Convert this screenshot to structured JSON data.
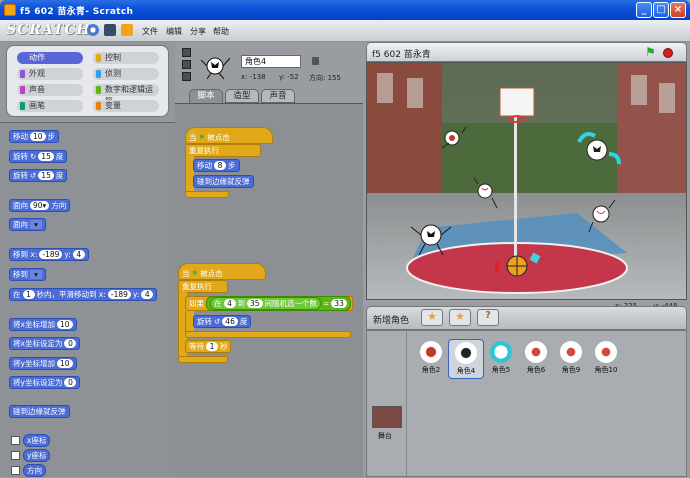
{
  "window": {
    "title": "f5 602 苗永青- Scratch",
    "buttons": [
      "_",
      "□",
      "×"
    ]
  },
  "menu": {
    "items": [
      "文件",
      "编辑",
      "分享",
      "帮助"
    ],
    "logo": "SCRATCH"
  },
  "categories": [
    {
      "label": "动作",
      "color": "#4a6cd4",
      "selected": true
    },
    {
      "label": "控制",
      "color": "#e1a91a"
    },
    {
      "label": "外观",
      "color": "#8a55d7"
    },
    {
      "label": "侦测",
      "color": "#2ca5e2"
    },
    {
      "label": "声音",
      "color": "#bb42c3"
    },
    {
      "label": "数字和逻辑运算",
      "color": "#5cb712"
    },
    {
      "label": "画笔",
      "color": "#0e9a6c"
    },
    {
      "label": "变量",
      "color": "#ee7d16"
    }
  ],
  "blocks": {
    "move": {
      "label": "移动",
      "value": "10",
      "unit": "步"
    },
    "turn_right": {
      "label": "旋转",
      "value": "15",
      "unit": "度"
    },
    "turn_left": {
      "label": "旋转",
      "value": "15",
      "unit": "度"
    },
    "point_dir": {
      "label": "面向",
      "value": "90▾",
      "unit": "方向"
    },
    "point_towards": {
      "label": "面向"
    },
    "goto_xy": {
      "label": "移到 x:",
      "x": "-189",
      "ylabel": "y:",
      "y": "4"
    },
    "goto": {
      "label": "移到"
    },
    "glide": {
      "label": "在",
      "secs": "1",
      "mid": "秒内，平滑移动到 x:",
      "x": "-189",
      "ylabel": "y:",
      "y": "4"
    },
    "change_x": {
      "label": "将x坐标增加",
      "value": "10"
    },
    "set_x": {
      "label": "将x坐标设定为",
      "value": "0"
    },
    "change_y": {
      "label": "将y坐标增加",
      "value": "10"
    },
    "set_y": {
      "label": "将y坐标设定为",
      "value": "0"
    },
    "bounce": {
      "label": "碰到边缘就反弹"
    },
    "xpos": {
      "label": "x座标"
    },
    "ypos": {
      "label": "y座标"
    },
    "dir": {
      "label": "方向"
    }
  },
  "sprite": {
    "name": "角色4",
    "x": "x: -138",
    "y": "y: -52",
    "dir": "方向: 155"
  },
  "tabs": [
    {
      "label": "脚本",
      "active": true
    },
    {
      "label": "造型"
    },
    {
      "label": "声音"
    }
  ],
  "script1": {
    "hat_when": "当",
    "hat_clicked": "被点击",
    "forever": "重复执行",
    "move": "移动",
    "move_val": "8",
    "move_unit": "步",
    "bounce": "碰到边缘就反弹"
  },
  "script2": {
    "hat_when": "当",
    "hat_clicked": "被点击",
    "forever": "重复执行",
    "if": "如果",
    "in": "在",
    "from": "4",
    "to_label": "到",
    "to": "35",
    "rand_text": "间随机选一个数",
    "eq": "=",
    "eqval": "33",
    "turn": "旋转",
    "turn_val": "46",
    "turn_unit": "度",
    "wait": "等待",
    "wait_val": "1",
    "wait_unit": "秒"
  },
  "stage": {
    "title": "f5 602 苗永青",
    "coords_x": "x: 225",
    "coords_y": "y: -448"
  },
  "spritebar": {
    "label": "新增角色"
  },
  "sprites": [
    {
      "name": "角色2",
      "color": "#c0392b"
    },
    {
      "name": "角色4",
      "color": "#222222",
      "selected": true
    },
    {
      "name": "角色5",
      "color": "#2fc4d6"
    },
    {
      "name": "角色6",
      "color": "#d04a3a"
    },
    {
      "name": "角色9",
      "color": "#d04a3a"
    },
    {
      "name": "角色10",
      "color": "#d04a3a"
    }
  ],
  "stage_thumb": {
    "label": "舞台"
  }
}
